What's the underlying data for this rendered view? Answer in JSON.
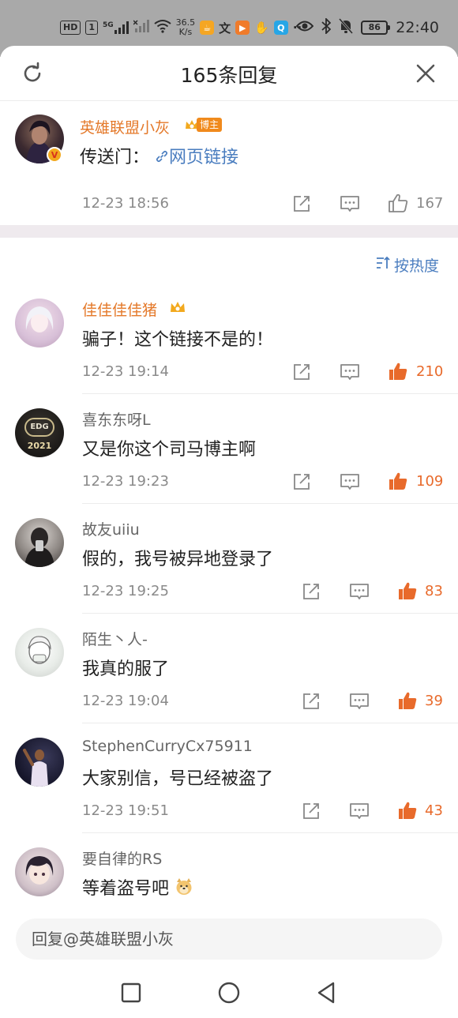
{
  "status_bar": {
    "chip_hd": "HD",
    "chip_sim": "1",
    "net_5g": "5G",
    "speed_value": "36.5",
    "speed_unit": "K/s",
    "battery": "86",
    "time": "22:40",
    "more": "···"
  },
  "header": {
    "title": "165条回复"
  },
  "main_comment": {
    "author": "英雄联盟小灰",
    "badge": "博主",
    "text_prefix": "传送门：",
    "link_text": "网页链接",
    "time": "12-23 18:56",
    "likes": "167"
  },
  "sort": {
    "label": "按热度"
  },
  "replies": [
    {
      "author": "佳佳佳佳猪",
      "text": "骗子！这个链接不是的！",
      "time": "12-23 19:14",
      "likes": "210",
      "author_color": "#e4792a"
    },
    {
      "author": "喜东东呀L",
      "text": "又是你这个司马博主啊",
      "time": "12-23 19:23",
      "likes": "109",
      "author_color": "#666666",
      "avatar_label": "EDG",
      "avatar_year": "2021"
    },
    {
      "author": "故友uiiu",
      "text": "假的，我号被异地登录了",
      "time": "12-23 19:25",
      "likes": "83",
      "author_color": "#666666"
    },
    {
      "author": "陌生丶人-",
      "text": "我真的服了",
      "time": "12-23 19:04",
      "likes": "39",
      "author_color": "#666666"
    },
    {
      "author": "StephenCurryCx75911",
      "text": "大家别信，号已经被盗了",
      "time": "12-23 19:51",
      "likes": "43",
      "author_color": "#666666"
    },
    {
      "author": "要自律的RS",
      "text": "等着盗号吧",
      "author_color": "#666666"
    }
  ],
  "reply_input": {
    "placeholder": "回复@英雄联盟小灰"
  },
  "colors": {
    "accent_orange": "#e86a2b",
    "link_blue": "#4a7dbf",
    "author_orange": "#e4792a"
  }
}
